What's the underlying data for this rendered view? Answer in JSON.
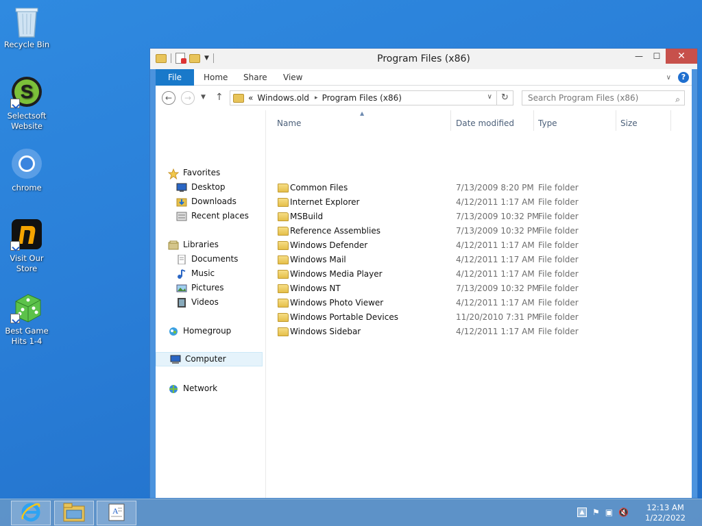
{
  "desktop": {
    "icons": [
      {
        "label": "Recycle Bin",
        "icon": "recycle-bin-icon"
      },
      {
        "label": "Selectsoft Website",
        "icon": "selectsoft-icon"
      },
      {
        "label": "chrome",
        "icon": "chrome-icon"
      },
      {
        "label": "Visit Our Store",
        "icon": "store-icon"
      },
      {
        "label": "Best Game Hits 1-4",
        "icon": "game-dice-icon"
      }
    ]
  },
  "window": {
    "title": "Program Files (x86)",
    "controls": {
      "minimize": "—",
      "maximize": "☐",
      "close": "✕"
    },
    "ribbon_tabs": [
      {
        "label": "File"
      },
      {
        "label": "Home"
      },
      {
        "label": "Share"
      },
      {
        "label": "View"
      }
    ],
    "help_label": "?",
    "address": {
      "prefix": "«",
      "crumbs": [
        "Windows.old",
        "Program Files (x86)"
      ],
      "separator": "▸"
    },
    "search": {
      "placeholder": "Search Program Files (x86)"
    },
    "nav_pane": {
      "items": [
        {
          "label": "Favorites",
          "icon": "star-icon"
        },
        {
          "label": "Desktop",
          "icon": "desktop-icon"
        },
        {
          "label": "Downloads",
          "icon": "downloads-icon"
        },
        {
          "label": "Recent places",
          "icon": "recent-places-icon"
        },
        {
          "label": "Libraries",
          "icon": "libraries-icon"
        },
        {
          "label": "Documents",
          "icon": "documents-icon"
        },
        {
          "label": "Music",
          "icon": "music-icon"
        },
        {
          "label": "Pictures",
          "icon": "pictures-icon"
        },
        {
          "label": "Videos",
          "icon": "videos-icon"
        },
        {
          "label": "Homegroup",
          "icon": "homegroup-icon"
        },
        {
          "label": "Computer",
          "icon": "computer-icon",
          "selected": true
        },
        {
          "label": "Network",
          "icon": "network-icon"
        }
      ]
    },
    "columns": {
      "name": "Name",
      "date": "Date modified",
      "type": "Type",
      "size": "Size"
    },
    "files": [
      {
        "name": "Common Files",
        "date": "7/13/2009 8:20 PM",
        "type": "File folder"
      },
      {
        "name": "Internet Explorer",
        "date": "4/12/2011 1:17 AM",
        "type": "File folder"
      },
      {
        "name": "MSBuild",
        "date": "7/13/2009 10:32 PM",
        "type": "File folder"
      },
      {
        "name": "Reference Assemblies",
        "date": "7/13/2009 10:32 PM",
        "type": "File folder"
      },
      {
        "name": "Windows Defender",
        "date": "4/12/2011 1:17 AM",
        "type": "File folder"
      },
      {
        "name": "Windows Mail",
        "date": "4/12/2011 1:17 AM",
        "type": "File folder"
      },
      {
        "name": "Windows Media Player",
        "date": "4/12/2011 1:17 AM",
        "type": "File folder"
      },
      {
        "name": "Windows NT",
        "date": "7/13/2009 10:32 PM",
        "type": "File folder"
      },
      {
        "name": "Windows Photo Viewer",
        "date": "4/12/2011 1:17 AM",
        "type": "File folder"
      },
      {
        "name": "Windows Portable Devices",
        "date": "11/20/2010 7:31 PM",
        "type": "File folder"
      },
      {
        "name": "Windows Sidebar",
        "date": "4/12/2011 1:17 AM",
        "type": "File folder"
      }
    ]
  },
  "taskbar": {
    "pinned": [
      {
        "icon": "internet-explorer-icon"
      },
      {
        "icon": "file-explorer-icon"
      },
      {
        "icon": "document-app-icon"
      }
    ],
    "clock": {
      "time": "12:13 AM",
      "date": "1/22/2022"
    },
    "tray": [
      "show-hidden-icons-icon",
      "action-center-flag-icon",
      "network-tray-icon",
      "volume-muted-icon"
    ]
  },
  "colors": {
    "accent": "#1979ca",
    "desktop": "#2a7fd8",
    "close": "#c7504b"
  }
}
